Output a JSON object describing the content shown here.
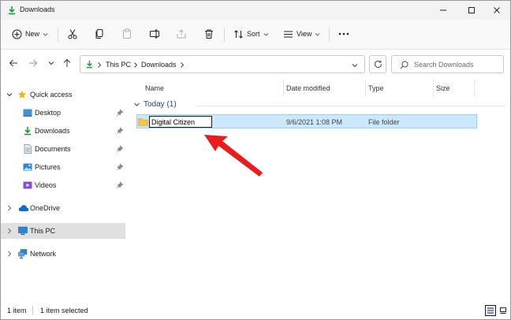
{
  "window": {
    "title": "Downloads"
  },
  "toolbar": {
    "new_label": "New",
    "sort_label": "Sort",
    "view_label": "View"
  },
  "address": {
    "crumbs": [
      "This PC",
      "Downloads"
    ],
    "search_placeholder": "Search Downloads"
  },
  "nav": {
    "quick_access": "Quick access",
    "desktop": "Desktop",
    "downloads": "Downloads",
    "documents": "Documents",
    "pictures": "Pictures",
    "videos": "Videos",
    "onedrive": "OneDrive",
    "this_pc": "This PC",
    "network": "Network"
  },
  "columns": {
    "name": "Name",
    "date_modified": "Date modified",
    "type": "Type",
    "size": "Size"
  },
  "group": {
    "label": "Today (1)"
  },
  "files": [
    {
      "name": "Digital Citizen",
      "date_modified": "9/6/2021 1:08 PM",
      "type": "File folder",
      "size": ""
    }
  ],
  "status": {
    "item_count": "1 item",
    "selected": "1 item selected"
  },
  "colors": {
    "accent": "#0067c0",
    "selection": "#cce8ff",
    "folder": "#f8c447",
    "annotation_arrow": "#e81d1d"
  }
}
